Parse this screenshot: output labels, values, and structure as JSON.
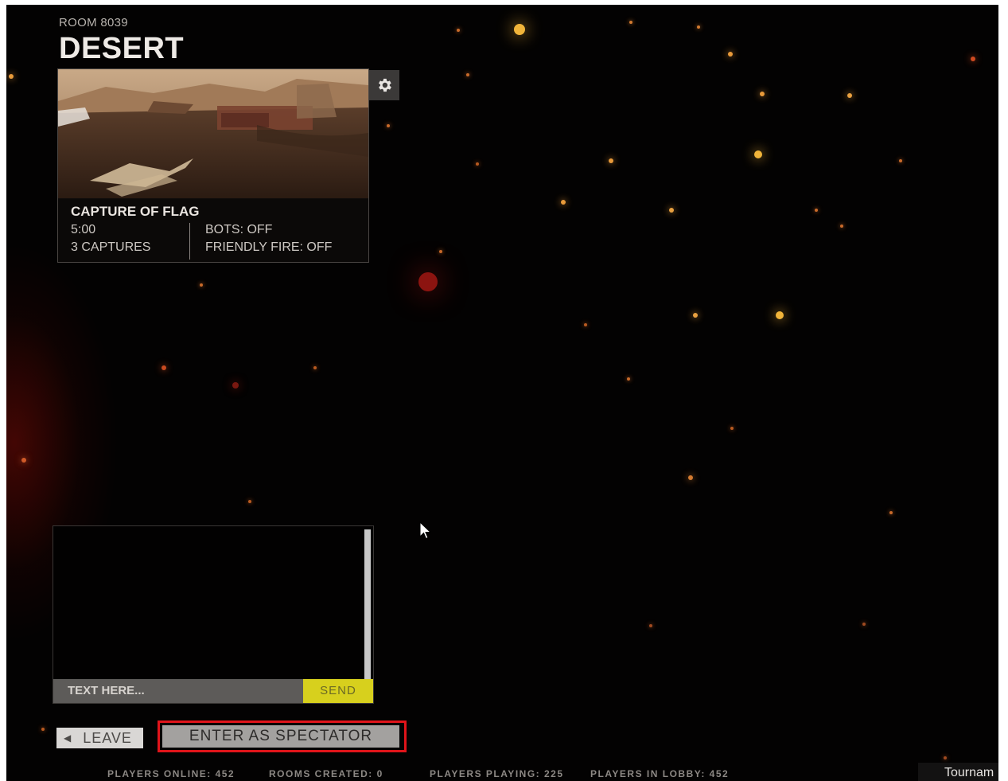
{
  "room": {
    "label": "ROOM 8039",
    "map_name": "DESERT"
  },
  "map_card": {
    "mode": "CAPTURE OF FLAG",
    "time_limit": "5:00",
    "captures": "3 CAPTURES",
    "bots": "BOTS: OFF",
    "friendly_fire": "FRIENDLY FIRE: OFF"
  },
  "settings": {
    "icon": "gear-icon"
  },
  "chat": {
    "input_placeholder": "TEXT HERE...",
    "send_label": "SEND"
  },
  "actions": {
    "leave_label": "LEAVE",
    "leave_icon": "triangle-left-icon",
    "spectator_label": "ENTER AS SPECTATOR"
  },
  "stats": {
    "players_online": "PLAYERS ONLINE: 452",
    "rooms_created": "ROOMS CREATED: 0",
    "players_playing": "PLAYERS PLAYING: 225",
    "players_in_lobby": "PLAYERS IN LOBBY: 452"
  },
  "tab": {
    "tournament_label": "Tournam"
  },
  "colors": {
    "send_button": "#d7d01d",
    "highlight_border": "#e0141a",
    "background": "#030202"
  }
}
